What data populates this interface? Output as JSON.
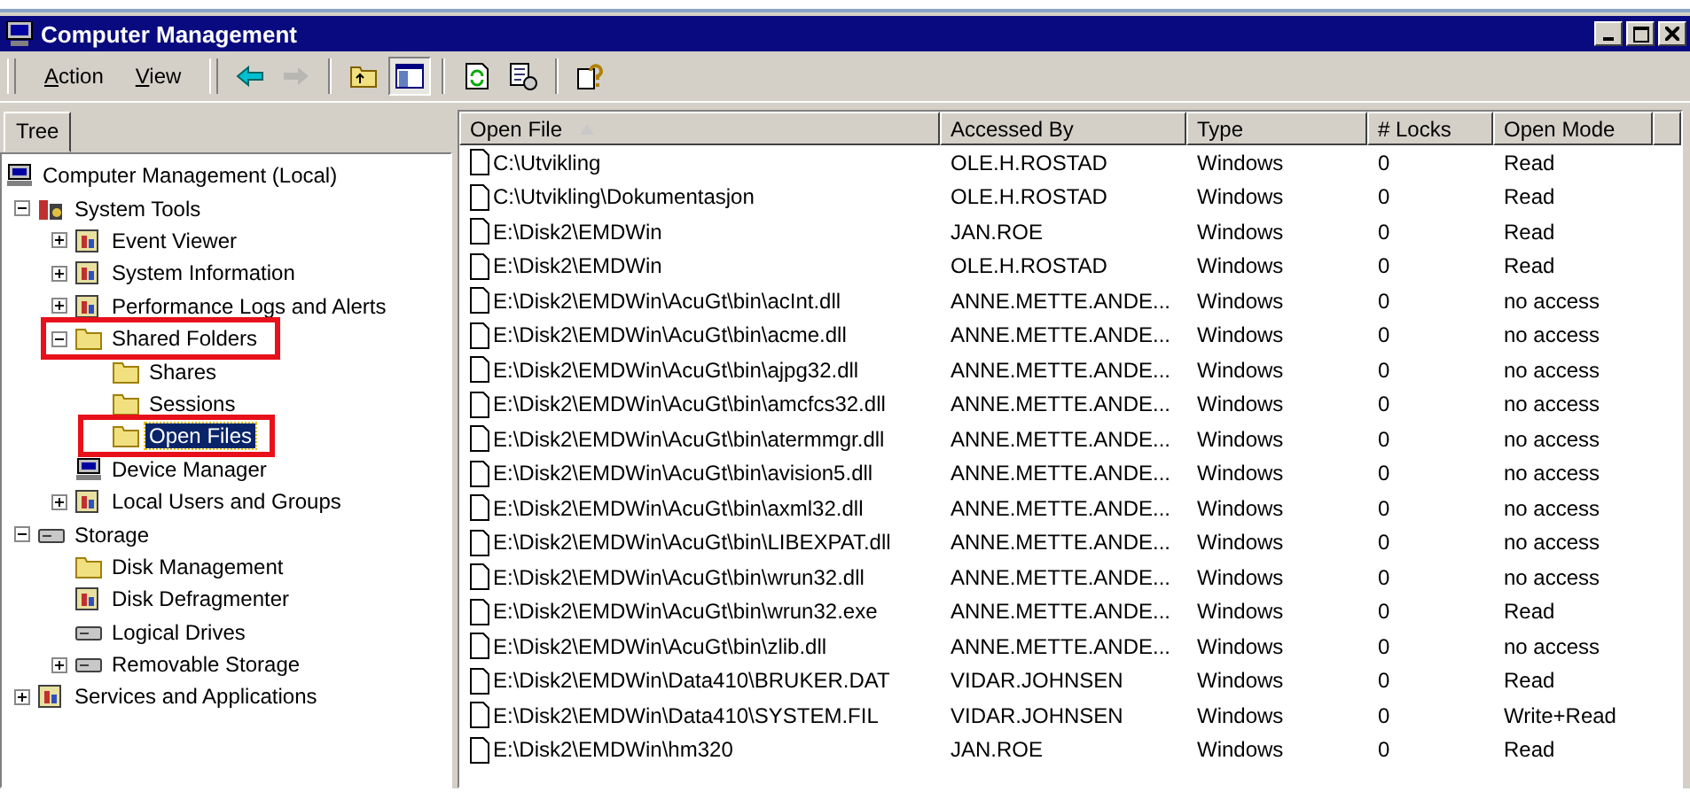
{
  "window": {
    "title": "Computer Management"
  },
  "menu": [
    {
      "label": "Action"
    },
    {
      "label": "View"
    }
  ],
  "toolbar": [
    {
      "kind": "back",
      "disabled": false
    },
    {
      "kind": "forward",
      "disabled": true
    },
    {
      "kind": "up",
      "disabled": false,
      "pressed": false
    },
    {
      "kind": "tree",
      "disabled": false,
      "pressed": true
    },
    {
      "kind": "refresh",
      "disabled": false
    },
    {
      "kind": "export",
      "disabled": false
    },
    {
      "kind": "help",
      "disabled": false
    }
  ],
  "tree_tab": {
    "label": "Tree"
  },
  "tree": [
    {
      "label": "Computer Management (Local)",
      "kind": "computer",
      "selected": false,
      "highlighted": false,
      "children": [
        {
          "label": "System Tools",
          "kind": "tools",
          "expanded": true,
          "selected": false,
          "highlighted": false,
          "children": [
            {
              "label": "Event Viewer",
              "kind": "app",
              "expanded": false,
              "selected": false,
              "highlighted": false
            },
            {
              "label": "System Information",
              "kind": "app",
              "expanded": false,
              "selected": false,
              "highlighted": false
            },
            {
              "label": "Performance Logs and Alerts",
              "kind": "app",
              "expanded": false,
              "selected": false,
              "highlighted": false
            },
            {
              "label": "Shared Folders",
              "kind": "folder",
              "expanded": true,
              "selected": false,
              "highlighted": true,
              "children": [
                {
                  "label": "Shares",
                  "kind": "folder",
                  "selected": false,
                  "highlighted": false
                },
                {
                  "label": "Sessions",
                  "kind": "folder",
                  "selected": false,
                  "highlighted": false
                },
                {
                  "label": "Open Files",
                  "kind": "folder",
                  "selected": true,
                  "highlighted": true
                }
              ]
            },
            {
              "label": "Device Manager",
              "kind": "computer",
              "selected": false,
              "highlighted": false
            },
            {
              "label": "Local Users and Groups",
              "kind": "app",
              "expanded": false,
              "selected": false,
              "highlighted": false
            }
          ]
        },
        {
          "label": "Storage",
          "kind": "drive",
          "expanded": true,
          "selected": false,
          "highlighted": false,
          "children": [
            {
              "label": "Disk Management",
              "kind": "folder",
              "selected": false,
              "highlighted": false
            },
            {
              "label": "Disk Defragmenter",
              "kind": "app",
              "selected": false,
              "highlighted": false
            },
            {
              "label": "Logical Drives",
              "kind": "drive",
              "selected": false,
              "highlighted": false
            },
            {
              "label": "Removable Storage",
              "kind": "drive",
              "expanded": false,
              "selected": false,
              "highlighted": false
            }
          ]
        },
        {
          "label": "Services and Applications",
          "kind": "app",
          "expanded": false,
          "selected": false,
          "highlighted": false
        }
      ]
    }
  ],
  "table": {
    "columns": [
      {
        "label": "Open File",
        "sorted": true
      },
      {
        "label": "Accessed By",
        "sorted": false
      },
      {
        "label": "Type",
        "sorted": false
      },
      {
        "label": "# Locks",
        "sorted": false
      },
      {
        "label": "Open Mode",
        "sorted": false
      }
    ],
    "rows": [
      [
        "C:\\Utvikling",
        "OLE.H.ROSTAD",
        "Windows",
        "0",
        "Read"
      ],
      [
        "C:\\Utvikling\\Dokumentasjon",
        "OLE.H.ROSTAD",
        "Windows",
        "0",
        "Read"
      ],
      [
        "E:\\Disk2\\EMDWin",
        "JAN.ROE",
        "Windows",
        "0",
        "Read"
      ],
      [
        "E:\\Disk2\\EMDWin",
        "OLE.H.ROSTAD",
        "Windows",
        "0",
        "Read"
      ],
      [
        "E:\\Disk2\\EMDWin\\AcuGt\\bin\\acInt.dll",
        "ANNE.METTE.ANDE...",
        "Windows",
        "0",
        "no access"
      ],
      [
        "E:\\Disk2\\EMDWin\\AcuGt\\bin\\acme.dll",
        "ANNE.METTE.ANDE...",
        "Windows",
        "0",
        "no access"
      ],
      [
        "E:\\Disk2\\EMDWin\\AcuGt\\bin\\ajpg32.dll",
        "ANNE.METTE.ANDE...",
        "Windows",
        "0",
        "no access"
      ],
      [
        "E:\\Disk2\\EMDWin\\AcuGt\\bin\\amcfcs32.dll",
        "ANNE.METTE.ANDE...",
        "Windows",
        "0",
        "no access"
      ],
      [
        "E:\\Disk2\\EMDWin\\AcuGt\\bin\\atermmgr.dll",
        "ANNE.METTE.ANDE...",
        "Windows",
        "0",
        "no access"
      ],
      [
        "E:\\Disk2\\EMDWin\\AcuGt\\bin\\avision5.dll",
        "ANNE.METTE.ANDE...",
        "Windows",
        "0",
        "no access"
      ],
      [
        "E:\\Disk2\\EMDWin\\AcuGt\\bin\\axml32.dll",
        "ANNE.METTE.ANDE...",
        "Windows",
        "0",
        "no access"
      ],
      [
        "E:\\Disk2\\EMDWin\\AcuGt\\bin\\LIBEXPAT.dll",
        "ANNE.METTE.ANDE...",
        "Windows",
        "0",
        "no access"
      ],
      [
        "E:\\Disk2\\EMDWin\\AcuGt\\bin\\wrun32.dll",
        "ANNE.METTE.ANDE...",
        "Windows",
        "0",
        "no access"
      ],
      [
        "E:\\Disk2\\EMDWin\\AcuGt\\bin\\wrun32.exe",
        "ANNE.METTE.ANDE...",
        "Windows",
        "0",
        "Read"
      ],
      [
        "E:\\Disk2\\EMDWin\\AcuGt\\bin\\zlib.dll",
        "ANNE.METTE.ANDE...",
        "Windows",
        "0",
        "no access"
      ],
      [
        "E:\\Disk2\\EMDWin\\Data410\\BRUKER.DAT",
        "VIDAR.JOHNSEN",
        "Windows",
        "0",
        "Read"
      ],
      [
        "E:\\Disk2\\EMDWin\\Data410\\SYSTEM.FIL",
        "VIDAR.JOHNSEN",
        "Windows",
        "0",
        "Write+Read"
      ],
      [
        "E:\\Disk2\\EMDWin\\hm320",
        "JAN.ROE",
        "Windows",
        "0",
        "Read"
      ]
    ]
  }
}
